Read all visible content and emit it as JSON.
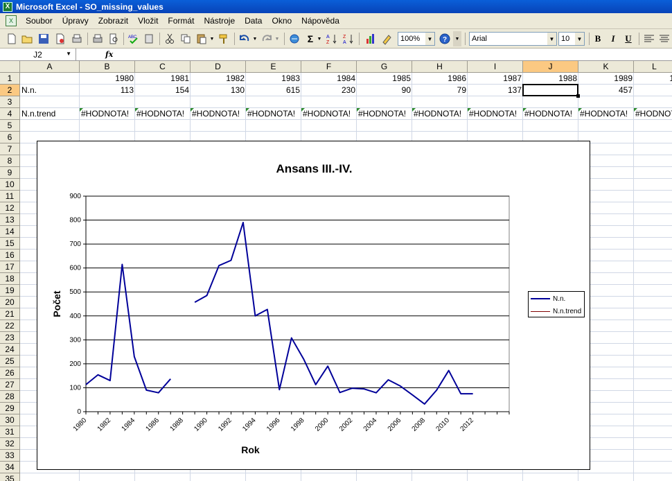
{
  "window": {
    "title": "Microsoft Excel - SO_missing_values"
  },
  "menu": [
    "Soubor",
    "Úpravy",
    "Zobrazit",
    "Vložit",
    "Formát",
    "Nástroje",
    "Data",
    "Okno",
    "Nápověda"
  ],
  "toolbar": {
    "zoom": "100%",
    "font_name": "Arial",
    "font_size": "10",
    "bold": "B",
    "italic": "I",
    "underline": "U"
  },
  "formula_bar": {
    "name_box": "J2",
    "fx": "fx",
    "content": ""
  },
  "columns": [
    "A",
    "B",
    "C",
    "D",
    "E",
    "F",
    "G",
    "H",
    "I",
    "J",
    "K",
    "L"
  ],
  "rows": [
    "1",
    "2",
    "3",
    "4",
    "5",
    "6",
    "7",
    "8",
    "9",
    "10",
    "11",
    "12",
    "13",
    "14",
    "15",
    "16",
    "17",
    "18",
    "19",
    "20",
    "21",
    "22",
    "23",
    "24",
    "25",
    "26",
    "27",
    "28",
    "29",
    "30",
    "31",
    "32",
    "33",
    "34",
    "35"
  ],
  "cells": {
    "row1": [
      "",
      "1980",
      "1981",
      "1982",
      "1983",
      "1984",
      "1985",
      "1986",
      "1987",
      "1988",
      "1989",
      "1"
    ],
    "row2": [
      "N.n.",
      "113",
      "154",
      "130",
      "615",
      "230",
      "90",
      "79",
      "137",
      "",
      "457",
      ""
    ],
    "row4_label": "N.n.trend",
    "row4_error": "#HODNOTA!"
  },
  "active_cell": "J2",
  "chart_data": {
    "type": "line",
    "title": "Ansans III.-IV.",
    "xlabel": "Rok",
    "ylabel": "Počet",
    "ylim": [
      0,
      900
    ],
    "yticks": [
      "0",
      "100",
      "200",
      "300",
      "400",
      "500",
      "600",
      "700",
      "800",
      "900"
    ],
    "xtick_labels": [
      "1980",
      "1982",
      "1984",
      "1986",
      "1988",
      "1990",
      "1992",
      "1994",
      "1996",
      "1998",
      "2000",
      "2002",
      "2004",
      "2006",
      "2008",
      "2010",
      "2012"
    ],
    "x": [
      1980,
      1981,
      1982,
      1983,
      1984,
      1985,
      1986,
      1987,
      1988,
      1989,
      1990,
      1991,
      1992,
      1993,
      1994,
      1995,
      1996,
      1997,
      1998,
      1999,
      2000,
      2001,
      2002,
      2003,
      2004,
      2005,
      2006,
      2007,
      2008,
      2009,
      2010,
      2011,
      2012
    ],
    "series": [
      {
        "name": "N.n.",
        "color": "#000099",
        "values": [
          113,
          154,
          130,
          615,
          230,
          90,
          79,
          137,
          null,
          457,
          485,
          610,
          632,
          790,
          400,
          427,
          92,
          308,
          220,
          113,
          190,
          80,
          98,
          95,
          79,
          133,
          107,
          70,
          32,
          90,
          172,
          75,
          75
        ]
      },
      {
        "name": "N.n.trend",
        "color": "#800000",
        "values": []
      }
    ],
    "grid": true,
    "legend": "right"
  }
}
